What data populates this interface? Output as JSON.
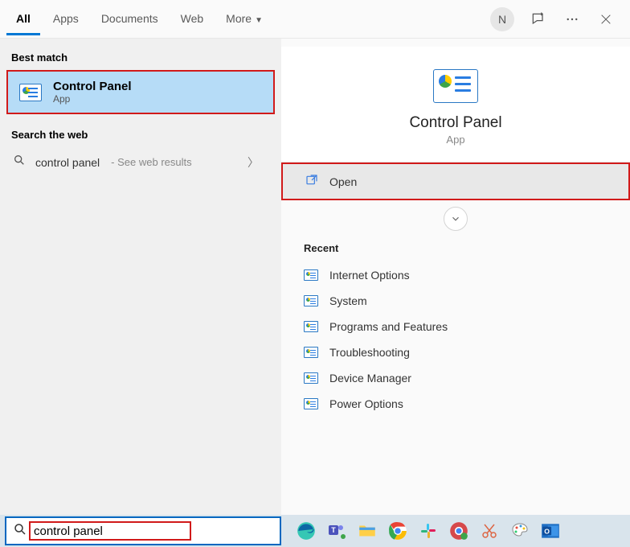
{
  "tabs": {
    "all": "All",
    "apps": "Apps",
    "documents": "Documents",
    "web": "Web",
    "more": "More"
  },
  "avatar_initial": "N",
  "sections": {
    "best_match": "Best match",
    "search_web": "Search the web",
    "recent": "Recent"
  },
  "best_match": {
    "title": "Control Panel",
    "subtitle": "App"
  },
  "web_result": {
    "query": "control panel",
    "hint": " - See web results"
  },
  "detail": {
    "title": "Control Panel",
    "subtitle": "App"
  },
  "actions": {
    "open": "Open"
  },
  "recent_items": [
    "Internet Options",
    "System",
    "Programs and Features",
    "Troubleshooting",
    "Device Manager",
    "Power Options"
  ],
  "search_input": "control panel"
}
